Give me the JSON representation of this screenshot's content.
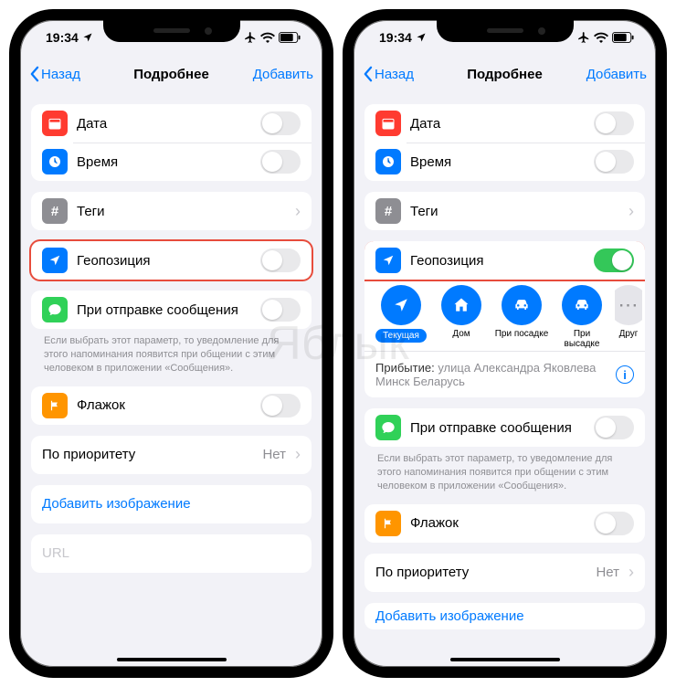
{
  "status": {
    "time": "19:34",
    "icons": [
      "airplane",
      "wifi",
      "battery"
    ]
  },
  "nav": {
    "back": "Назад",
    "title": "Подробнее",
    "add": "Добавить"
  },
  "rows": {
    "date": "Дата",
    "time": "Время",
    "tags": "Теги",
    "location": "Геопозиция",
    "messaging": "При отправке сообщения",
    "flag": "Флажок",
    "priority": "По приоритету",
    "priority_value": "Нет",
    "add_image": "Добавить изображение",
    "url_placeholder": "URL"
  },
  "messaging_footer": "Если выбрать этот параметр, то уведомление для этого напоминания появится при общении с этим человеком в приложении «Сообщения».",
  "location_options": {
    "current": "Текущая",
    "home": "Дом",
    "getting_in": "При посадке",
    "getting_out": "При высадке",
    "other": "Друг"
  },
  "arrival": {
    "label": "Прибытие:",
    "address": "улица Александра Яковлева Минск Беларусь"
  },
  "colors": {
    "red": "#ff3b30",
    "blue": "#007aff",
    "gray": "#8e8e93",
    "green_msg": "#30d158",
    "orange": "#ff9500",
    "toggle_on": "#34c759"
  },
  "watermark": "Яблык"
}
